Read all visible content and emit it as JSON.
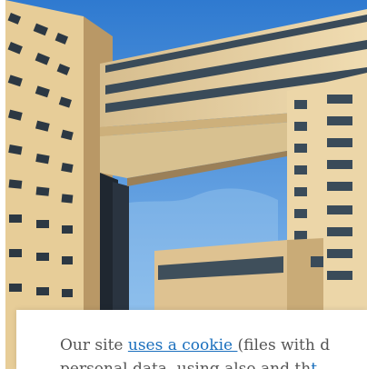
{
  "photo": {
    "subject": "building-photo",
    "colors": {
      "sky": "#3f86d6",
      "facade": "#e9d3a4",
      "facade_shadow": "#b99f72",
      "window": "#3a4a57"
    }
  },
  "cookie_banner": {
    "text_before": "Our site ",
    "link_label": "uses a cookie ",
    "text_after": "(files with d",
    "line2_visible": "personal data, using also and th",
    "line2_link": "t",
    "colors": {
      "text": "#555555",
      "link": "#1a6fbd"
    }
  }
}
